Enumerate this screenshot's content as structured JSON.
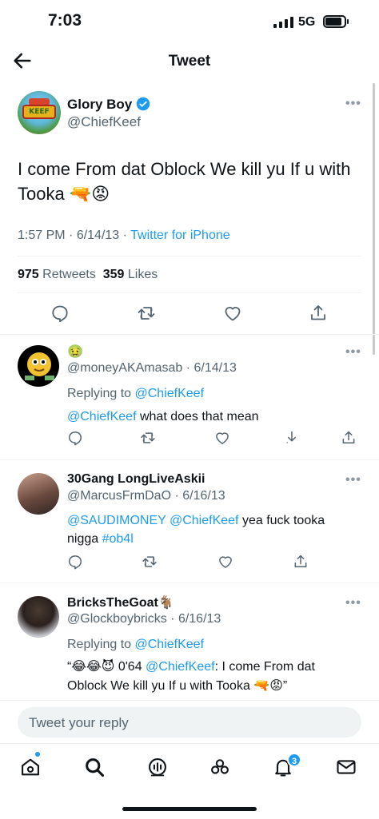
{
  "status_bar": {
    "time": "7:03",
    "network": "5G"
  },
  "header": {
    "title": "Tweet"
  },
  "tweet": {
    "author_name": "Glory Boy",
    "author_handle": "@ChiefKeef",
    "text": "I come From dat Oblock We kill yu If u with Tooka 🔫😡",
    "time": "1:57 PM",
    "date": "6/14/13",
    "source": "Twitter for iPhone",
    "retweets": "975",
    "retweets_label": "Retweets",
    "likes": "359",
    "likes_label": "Likes"
  },
  "replies": [
    {
      "name": "🤢",
      "handle": "@moneyAKAmasab",
      "date": "6/14/13",
      "replying_prefix": "Replying to",
      "replying_to": "@ChiefKeef",
      "mention": "@ChiefKeef",
      "text": "what does that mean"
    },
    {
      "name": "30Gang LongLiveAskii",
      "handle": "@MarcusFrmDaO",
      "date": "6/16/13",
      "mention1": "@SAUDIMONEY",
      "mention2": "@ChiefKeef",
      "text": "yea fuck tooka nigga",
      "hashtag": "#ob4l"
    },
    {
      "name": "BricksTheGoat🐐",
      "handle": "@Glockboybricks",
      "date": "6/16/13",
      "replying_prefix": "Replying to",
      "replying_to": "@ChiefKeef",
      "quote_open": "“😂😂😈 0'64",
      "mention": "@ChiefKeef",
      "quote_text_1": ": I come From dat",
      "quote_text_2": "Oblock We kill yu If u with Tooka 🔫😡”"
    }
  ],
  "compose": {
    "placeholder": "Tweet your reply"
  },
  "tabbar": {
    "notifications_badge": "3"
  },
  "colors": {
    "accent": "#1d9bf0",
    "text": "#0f1419",
    "muted": "#536471"
  }
}
